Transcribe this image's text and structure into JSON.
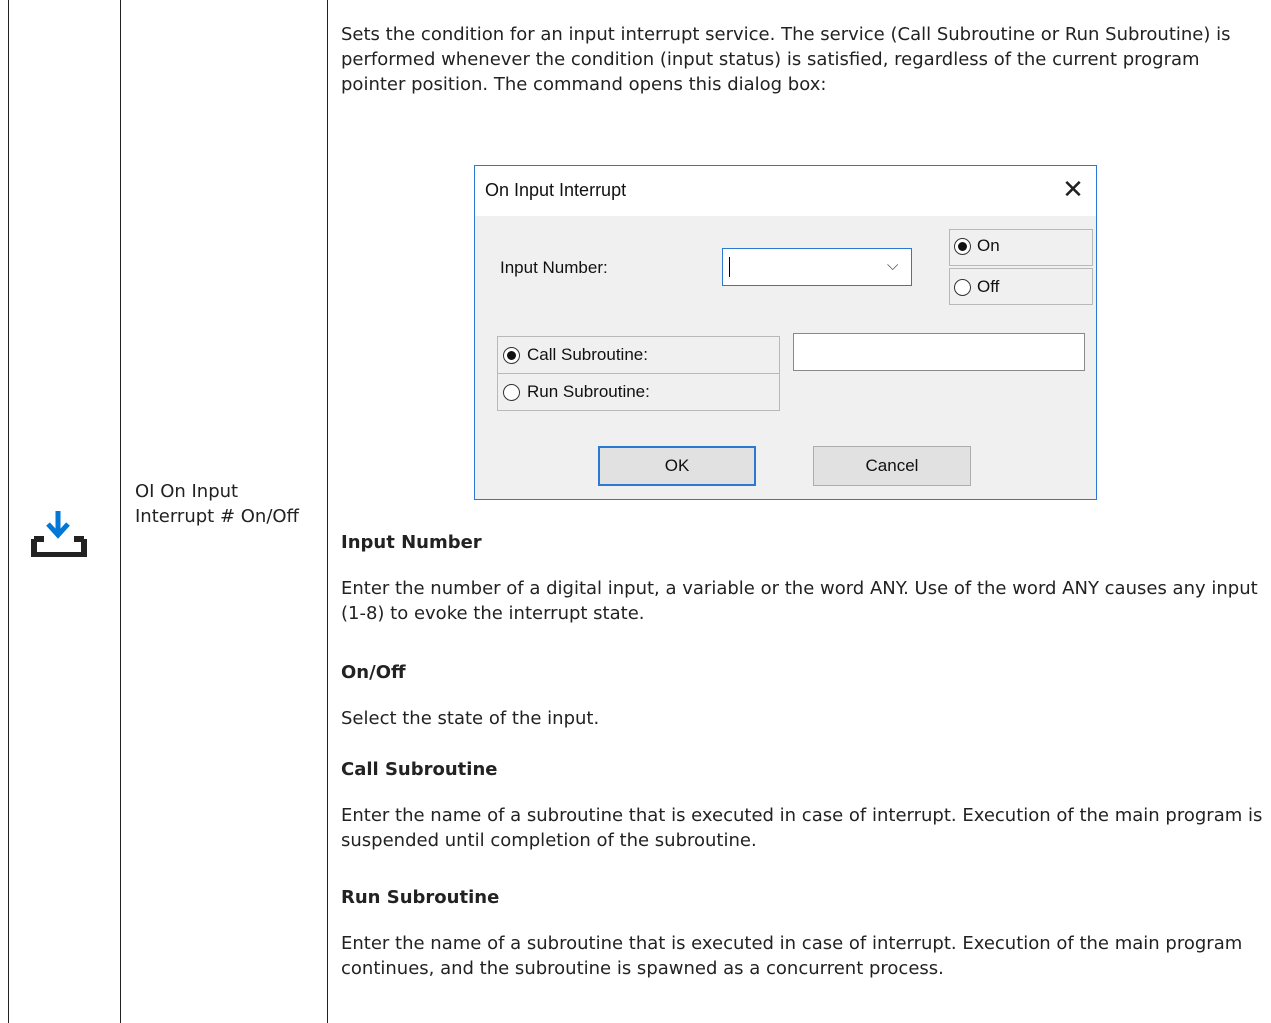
{
  "row": {
    "command_label": "OI On Input Interrupt # On/Off",
    "icon": "download-to-tray-icon",
    "intro": "Sets the condition for an input interrupt service. The service (Call Subroutine or Run Subroutine) is performed whenever the condition (input status) is satisfied, regardless of the current program pointer position. The command opens this dialog box:"
  },
  "dialog": {
    "title": "On Input Interrupt",
    "close_glyph": "✕",
    "input_number_label": "Input Number:",
    "input_number_value": "",
    "combo_chevron": "⌵",
    "state_on_label": "On",
    "state_off_label": "Off",
    "call_label": "Call Subroutine:",
    "run_label": "Run Subroutine:",
    "subroutine_value": "",
    "ok_label": "OK",
    "cancel_label": "Cancel"
  },
  "sections": [
    {
      "heading": "Input Number",
      "text": "Enter the number of a digital input, a variable or the word ANY. Use of the word ANY causes any input (1-8) to evoke the interrupt state."
    },
    {
      "heading": "On/Off",
      "text": "Select the state of the input."
    },
    {
      "heading": "Call Subroutine",
      "text": "Enter the name of a subroutine that is executed in case of interrupt. Execution of the main program is suspended until completion of the subroutine."
    },
    {
      "heading": "Run Subroutine",
      "text": "Enter the name of a subroutine that is executed in case of interrupt. Execution of the main program continues, and the subroutine is spawned as a concurrent process."
    }
  ],
  "colors": {
    "accent": "#0078d7",
    "icon_dark": "#222222"
  }
}
